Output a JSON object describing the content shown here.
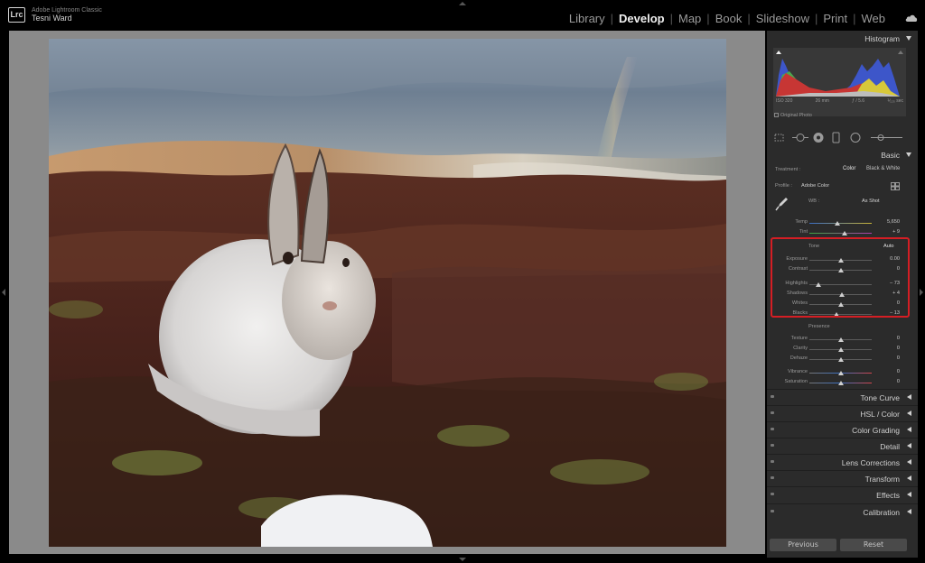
{
  "app": {
    "icon_label": "Lrc",
    "name": "Adobe Lightroom Classic",
    "user": "Tesni Ward"
  },
  "modules": [
    {
      "label": "Library",
      "active": false
    },
    {
      "label": "Develop",
      "active": true
    },
    {
      "label": "Map",
      "active": false
    },
    {
      "label": "Book",
      "active": false
    },
    {
      "label": "Slideshow",
      "active": false
    },
    {
      "label": "Print",
      "active": false
    },
    {
      "label": "Web",
      "active": false
    }
  ],
  "icons": {
    "cloud": "cloud-icon",
    "logo": "lrc-logo-icon",
    "eyedropper": "eyedropper-icon",
    "grid": "profile-browser-icon"
  },
  "histogram": {
    "title": "Histogram",
    "meta": [
      "ISO 320",
      "26 mm",
      "ƒ / 5.6",
      "⅟₁₂₅ sec"
    ],
    "original_photo": "Original Photo"
  },
  "basic": {
    "title": "Basic",
    "treatment_label": "Treatment :",
    "treatment_color": "Color",
    "treatment_bw": "Black & White",
    "profile_label": "Profile :",
    "profile_value": "Adobe Color",
    "wb_label": "WB :",
    "wb_value": "As Shot",
    "tone_label": "Tone",
    "auto_label": "Auto",
    "presence_label": "Presence",
    "sliders": {
      "temp": {
        "label": "Temp",
        "value": "5,650",
        "pos": 0.45
      },
      "tint": {
        "label": "Tint",
        "value": "+ 9",
        "pos": 0.56
      },
      "exposure": {
        "label": "Exposure",
        "value": "0.00",
        "pos": 0.5
      },
      "contrast": {
        "label": "Contrast",
        "value": "0",
        "pos": 0.5
      },
      "highlights": {
        "label": "Highlights",
        "value": "– 73",
        "pos": 0.14
      },
      "shadows": {
        "label": "Shadows",
        "value": "+ 4",
        "pos": 0.52
      },
      "whites": {
        "label": "Whites",
        "value": "0",
        "pos": 0.5
      },
      "blacks": {
        "label": "Blacks",
        "value": "– 13",
        "pos": 0.43
      },
      "texture": {
        "label": "Texture",
        "value": "0",
        "pos": 0.5
      },
      "clarity": {
        "label": "Clarity",
        "value": "0",
        "pos": 0.5
      },
      "dehaze": {
        "label": "Dehaze",
        "value": "0",
        "pos": 0.5
      },
      "vibrance": {
        "label": "Vibrance",
        "value": "0",
        "pos": 0.5
      },
      "saturation": {
        "label": "Saturation",
        "value": "0",
        "pos": 0.5
      }
    }
  },
  "sections": [
    "Tone Curve",
    "HSL / Color",
    "Color Grading",
    "Detail",
    "Lens Corrections",
    "Transform",
    "Effects",
    "Calibration"
  ],
  "buttons": {
    "previous": "Previous",
    "reset": "Reset"
  },
  "colors": {
    "highlight_box": "#d51e24",
    "panel_bg": "#2b2b2b",
    "canvas_bg": "#8a8a8a"
  }
}
